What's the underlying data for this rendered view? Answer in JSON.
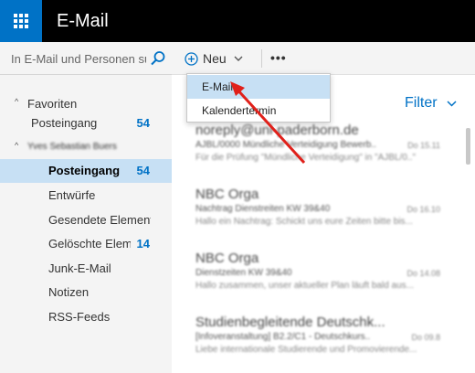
{
  "header": {
    "title": "E-Mail",
    "menu_icon": "waffle-icon"
  },
  "search": {
    "placeholder": "In E-Mail und Personen su...",
    "icon": "search-icon"
  },
  "favorites": {
    "label": "Favoriten",
    "items": [
      {
        "label": "Posteingang",
        "count": "54"
      }
    ]
  },
  "account": {
    "label": "Yves Sebastian Buers",
    "folders": [
      {
        "label": "Posteingang",
        "count": "54"
      },
      {
        "label": "Entwürfe",
        "count": ""
      },
      {
        "label": "Gesendete Elemente",
        "count": ""
      },
      {
        "label": "Gelöschte Elemente",
        "count": "14"
      },
      {
        "label": "Junk-E-Mail",
        "count": ""
      },
      {
        "label": "Notizen",
        "count": ""
      },
      {
        "label": "RSS-Feeds",
        "count": ""
      }
    ]
  },
  "toolbar": {
    "new_label": "Neu",
    "more_label": "•••"
  },
  "new_menu": {
    "items": [
      "E-Mail",
      "Kalendertermin"
    ]
  },
  "list": {
    "filter_label": "Filter",
    "messages": [
      {
        "sender": "noreply@uni-paderborn.de",
        "subject": "AJBL/0000 Mündliche Verteidigung Bewerb..",
        "date": "Do 15.11",
        "preview": "Für die Prüfung \"Mündliche Verteidigung\" in \"AJBL/0..\""
      },
      {
        "sender": "NBC Orga",
        "subject": "Nachtrag Dienstreiten KW 39&40",
        "date": "Do 16.10",
        "preview": "Hallo ein Nachtrag: Schickt uns eure Zeiten bitte bis..."
      },
      {
        "sender": "NBC Orga",
        "subject": "Dienstzeiten KW 39&40",
        "date": "Do 14.08",
        "preview": "Hallo zusammen, unser aktueller Plan läuft bald aus..."
      },
      {
        "sender": "Studienbegleitende Deutschk...",
        "subject": "[Infoveranstaltung] B2.2/C1 - Deutschkurs..",
        "date": "Do 09.8",
        "preview": "Liebe internationale Studierende und Promovierende..."
      }
    ]
  },
  "colors": {
    "accent": "#0072c6",
    "selected": "#c7e0f4",
    "annotation_arrow": "#e0201a"
  }
}
